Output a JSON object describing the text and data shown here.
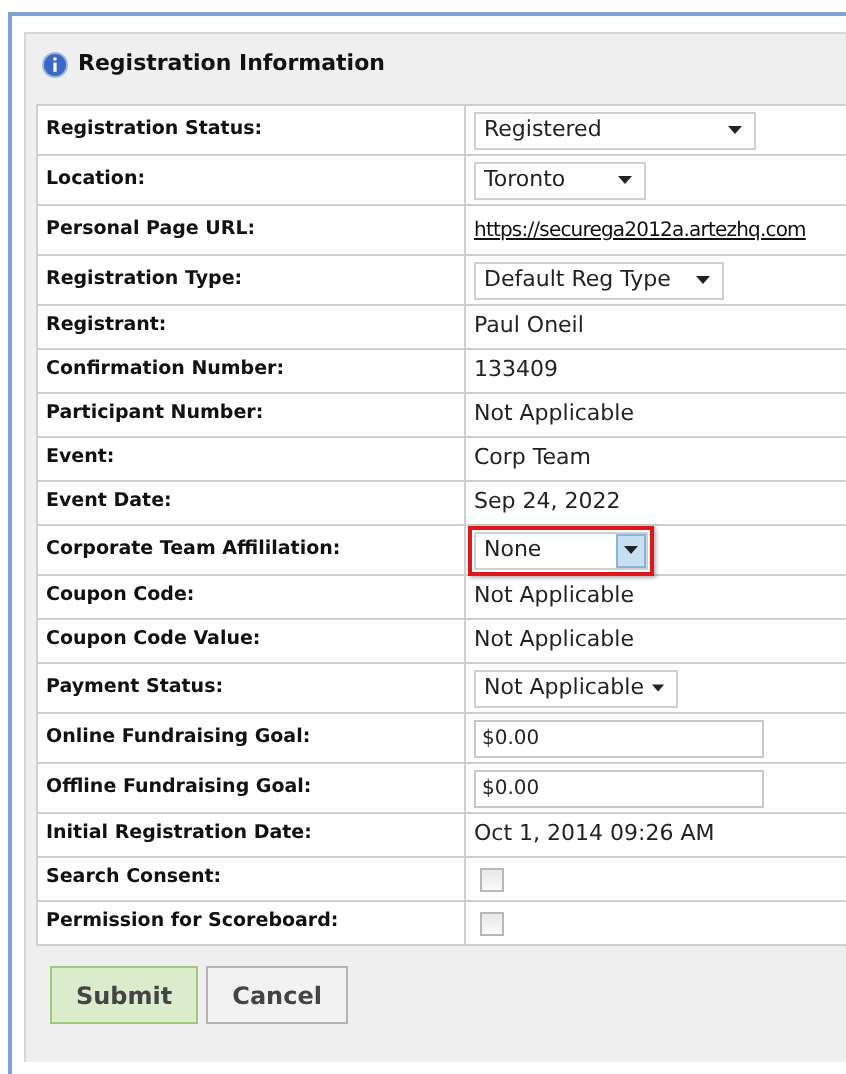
{
  "panel": {
    "title": "Registration Information"
  },
  "rows": [
    {
      "label": "Registration Status:",
      "kind": "select",
      "value": "Registered",
      "highlighted": false
    },
    {
      "label": "Location:",
      "kind": "select",
      "value": "Toronto",
      "highlighted": false
    },
    {
      "label": "Personal Page URL:",
      "kind": "link",
      "value": "https://securega2012a.artezhq.com"
    },
    {
      "label": "Registration Type:",
      "kind": "select",
      "value": "Default Reg Type",
      "highlighted": false
    },
    {
      "label": "Registrant:",
      "kind": "text",
      "value": "Paul Oneil"
    },
    {
      "label": "Confirmation Number:",
      "kind": "text",
      "value": "133409"
    },
    {
      "label": "Participant Number:",
      "kind": "text",
      "value": "Not Applicable"
    },
    {
      "label": "Event:",
      "kind": "text",
      "value": "Corp Team"
    },
    {
      "label": "Event Date:",
      "kind": "text",
      "value": "Sep 24, 2022"
    },
    {
      "label": "Corporate Team Affililation:",
      "kind": "select",
      "value": "None",
      "highlighted": true
    },
    {
      "label": "Coupon Code:",
      "kind": "text",
      "value": "Not Applicable"
    },
    {
      "label": "Coupon Code Value:",
      "kind": "text",
      "value": "Not Applicable"
    },
    {
      "label": "Payment Status:",
      "kind": "select",
      "value": "Not Applicable",
      "highlighted": false
    },
    {
      "label": "Online Fundraising Goal:",
      "kind": "input",
      "value": "$0.00"
    },
    {
      "label": "Offline Fundraising Goal:",
      "kind": "input",
      "value": "$0.00"
    },
    {
      "label": "Initial Registration Date:",
      "kind": "text",
      "value": "Oct 1, 2014 09:26 AM"
    },
    {
      "label": "Search Consent:",
      "kind": "checkbox",
      "checked": false
    },
    {
      "label": "Permission for Scoreboard:",
      "kind": "checkbox",
      "checked": false
    }
  ],
  "buttons": [
    {
      "label": "Submit",
      "kind": "primary"
    },
    {
      "label": "Cancel",
      "kind": "secondary"
    }
  ]
}
